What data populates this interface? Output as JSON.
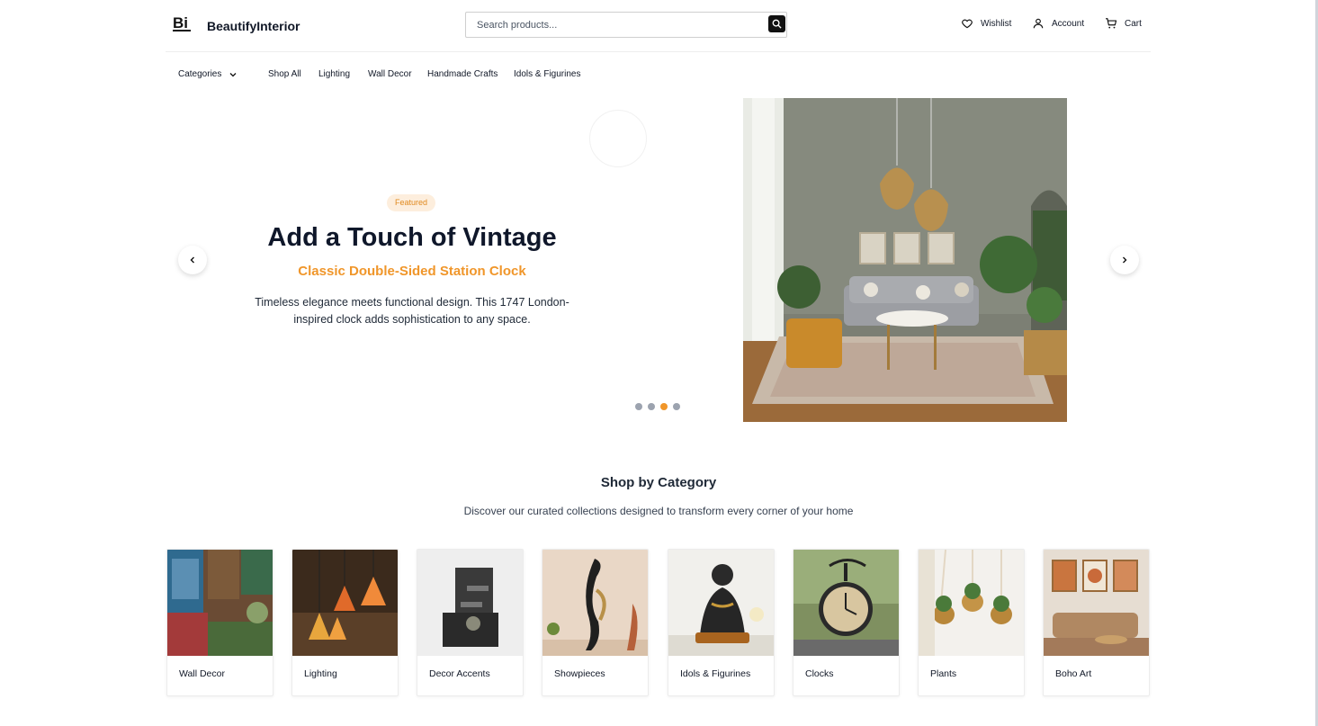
{
  "header": {
    "logo_text": "Bi",
    "brand": "BeautifyInterior",
    "search_placeholder": "Search products...",
    "wishlist": "Wishlist",
    "account": "Account",
    "cart": "Cart"
  },
  "nav": {
    "categories": "Categories",
    "items": [
      "Shop All",
      "Lighting",
      "Wall Decor",
      "Handmade Crafts",
      "Idols & Figurines"
    ]
  },
  "hero": {
    "badge": "Featured",
    "title": "Add a Touch of Vintage",
    "subtitle": "Classic Double-Sided Station Clock",
    "description": "Timeless elegance meets functional design. This 1747 London-inspired clock adds sophistication to any space.",
    "slides": 4,
    "active_slide": 3
  },
  "categories_section": {
    "title": "Shop by Category",
    "subtitle": "Discover our curated collections designed to transform every corner of your home",
    "items": [
      {
        "label": "Wall Decor"
      },
      {
        "label": "Lighting"
      },
      {
        "label": "Decor Accents"
      },
      {
        "label": "Showpieces"
      },
      {
        "label": "Idols & Figurines"
      },
      {
        "label": "Clocks"
      },
      {
        "label": "Plants"
      },
      {
        "label": "Boho Art"
      }
    ]
  },
  "colors": {
    "accent": "#f0962a",
    "badge_bg": "#fdeedd",
    "dark": "#111111"
  }
}
